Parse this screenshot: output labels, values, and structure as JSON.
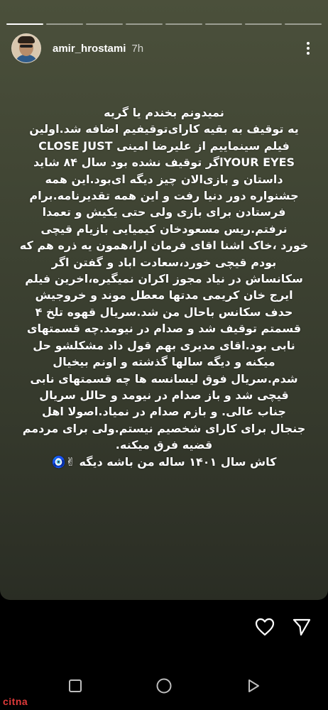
{
  "story": {
    "progress_segments": 8,
    "current_segment": 1,
    "header": {
      "username": "amir_hrostami",
      "time": "7h",
      "more_icon": "more-vertical-icon"
    },
    "text_lines": [
      "نمیدونم بخندم یا گریه",
      "یه توقیف به بقیه کارای‌توقیفیم اضافه شد.اولین",
      "فیلم سینماییم از علیرضا امینی CLOSE JUST",
      "YOUR EYESاگر توقیف نشده بود سال ۸۴ شاید",
      "داستان و بازی‌الان چیز دیگه ای‌بود.این همه",
      "جشنواره دور دنیا رفت و این همه تقدیرنامه.برام",
      "فرستادن برای بازی ولی حتی یکیش و تعمدا",
      "نرفتم.ریس مسعودخان کیمیایی بازیام قیچی",
      "خورد ،خاک اشنا اقای فرمان ارا،همون یه ذره هم که",
      "بودم قیچی خورد،سعادت اباد و گفتن اگر",
      "سکانساش در نیاد مجوز اکران نمیگیره،اخرین فیلم",
      "ایرج خان کریمی مدتها معطل موند و خروجیش",
      "حدف سکانس باحال من شد.سریال قهوه تلخ ۴",
      "قسمتم توقیف شد و صدام در نیومد.چه قسمتهای",
      "نابی بود.اقای مدیری بهم قول داد مشکلشو حل",
      "میکنه و دیگه سالها گذشته و اونم بیخیال",
      "شدم.سریال فوق لیسانسه ها چه قسمتهای نابی",
      "قیچی شد و باز صدام در نیومد و حالل سریال",
      "جناب عالی. و بازم صدام در نمیاد.اصولا اهل",
      "جنجال برای کارای شخصیم نیستم.ولی برای مردمم",
      "قضیه فرق میکنه.",
      "کاش سال ۱۴۰۱ ساله من باشه دیگه ✌🧿"
    ]
  },
  "actions": {
    "like_icon": "heart-icon",
    "share_icon": "send-icon"
  },
  "navbar": {
    "recents_icon": "square-icon",
    "home_icon": "circle-icon",
    "back_icon": "triangle-back-icon"
  },
  "watermark": "citna",
  "colors": {
    "story_bg_top": "#4b503b",
    "story_bg_bottom": "#2a2d24",
    "watermark": "#e03a3a"
  }
}
